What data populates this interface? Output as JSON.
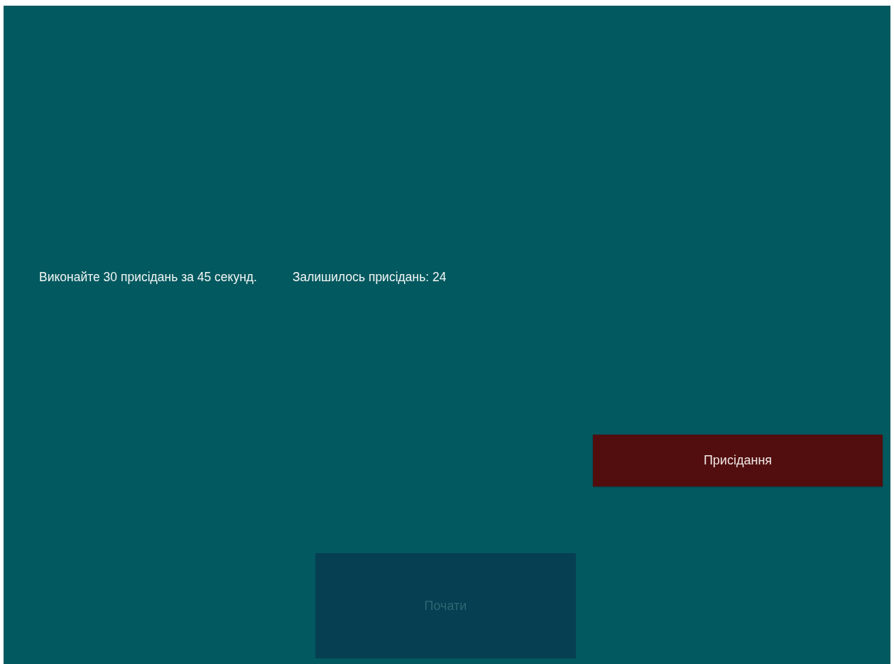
{
  "task": {
    "instruction": "Виконайте 30 присідань за 45 секунд.",
    "remaining": "Залишилось присідань: 24"
  },
  "buttons": [
    {
      "kind": "action",
      "label": "Присідання",
      "disabled": false
    },
    {
      "kind": "start",
      "label": "Почати",
      "disabled": true
    }
  ]
}
